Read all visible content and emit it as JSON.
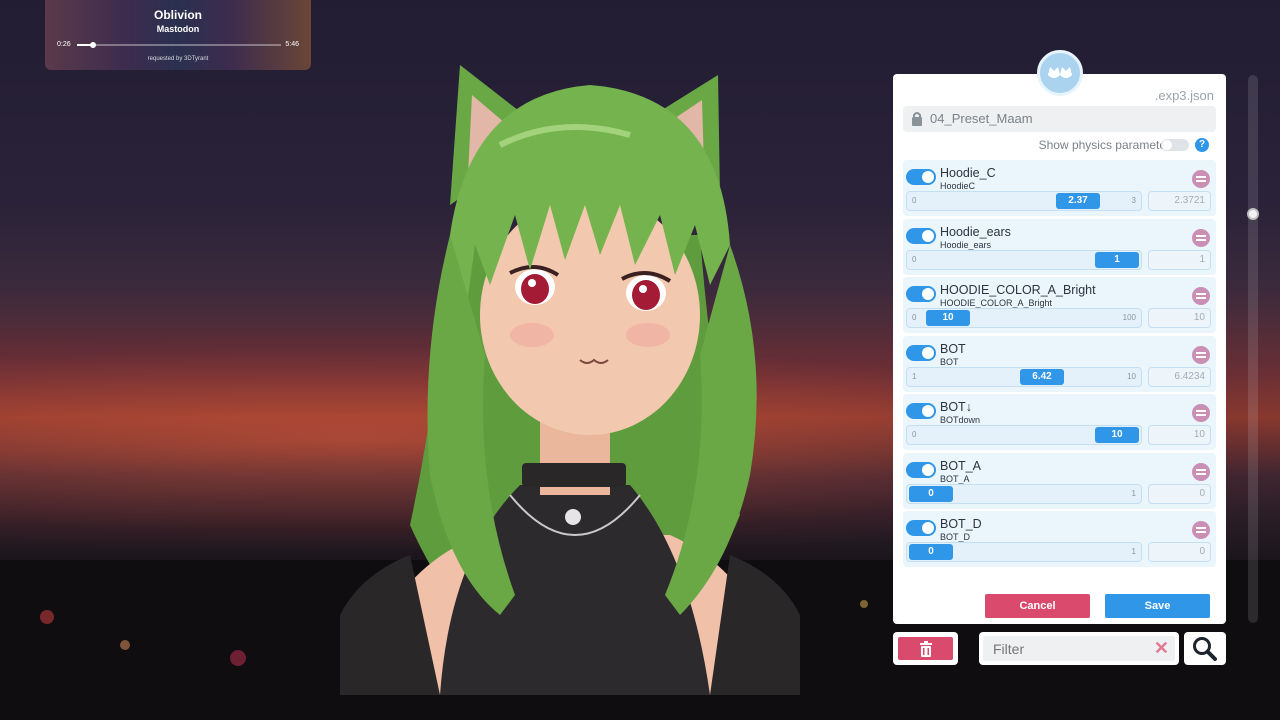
{
  "music": {
    "song": "Oblivion",
    "artist": "Mastodon",
    "current_time": "0:26",
    "end_time": "5:46",
    "progress": 0.08,
    "requested_by": "requested by 3DTyrant"
  },
  "panel": {
    "file_ext": ".exp3.json",
    "preset_name": "04_Preset_Maam",
    "physics_label": "Show physics parameters",
    "physics_on": false,
    "help": "?",
    "params": [
      {
        "name": "Hoodie_C",
        "id": "HoodieC",
        "min": "0",
        "max": "3",
        "value": "2.37",
        "exact": "2.3721",
        "fraction": 0.79
      },
      {
        "name": "Hoodie_ears",
        "id": "Hoodie_ears",
        "min": "0",
        "max": "",
        "value": "1",
        "exact": "1",
        "fraction": 1.0
      },
      {
        "name": "HOODIE_COLOR_A_Bright",
        "id": "HOODIE_COLOR_A_Bright",
        "min": "0",
        "max": "100",
        "value": "10",
        "exact": "10",
        "fraction": 0.1
      },
      {
        "name": "BOT",
        "id": "BOT",
        "min": "1",
        "max": "10",
        "value": "6.42",
        "exact": "6.4234",
        "fraction": 0.6
      },
      {
        "name": "BOT↓",
        "id": "BOTdown",
        "min": "0",
        "max": "",
        "value": "10",
        "exact": "10",
        "fraction": 1.0
      },
      {
        "name": "BOT_A",
        "id": "BOT_A",
        "min": "",
        "max": "1",
        "value": "0",
        "exact": "0",
        "fraction": 0.0
      },
      {
        "name": "BOT_D",
        "id": "BOT_D",
        "min": "",
        "max": "1",
        "value": "0",
        "exact": "0",
        "fraction": 0.0
      }
    ],
    "cancel_label": "Cancel",
    "save_label": "Save"
  },
  "filter": {
    "placeholder": "Filter"
  },
  "colors": {
    "accent": "#2f96e8",
    "danger": "#d94a6d"
  }
}
